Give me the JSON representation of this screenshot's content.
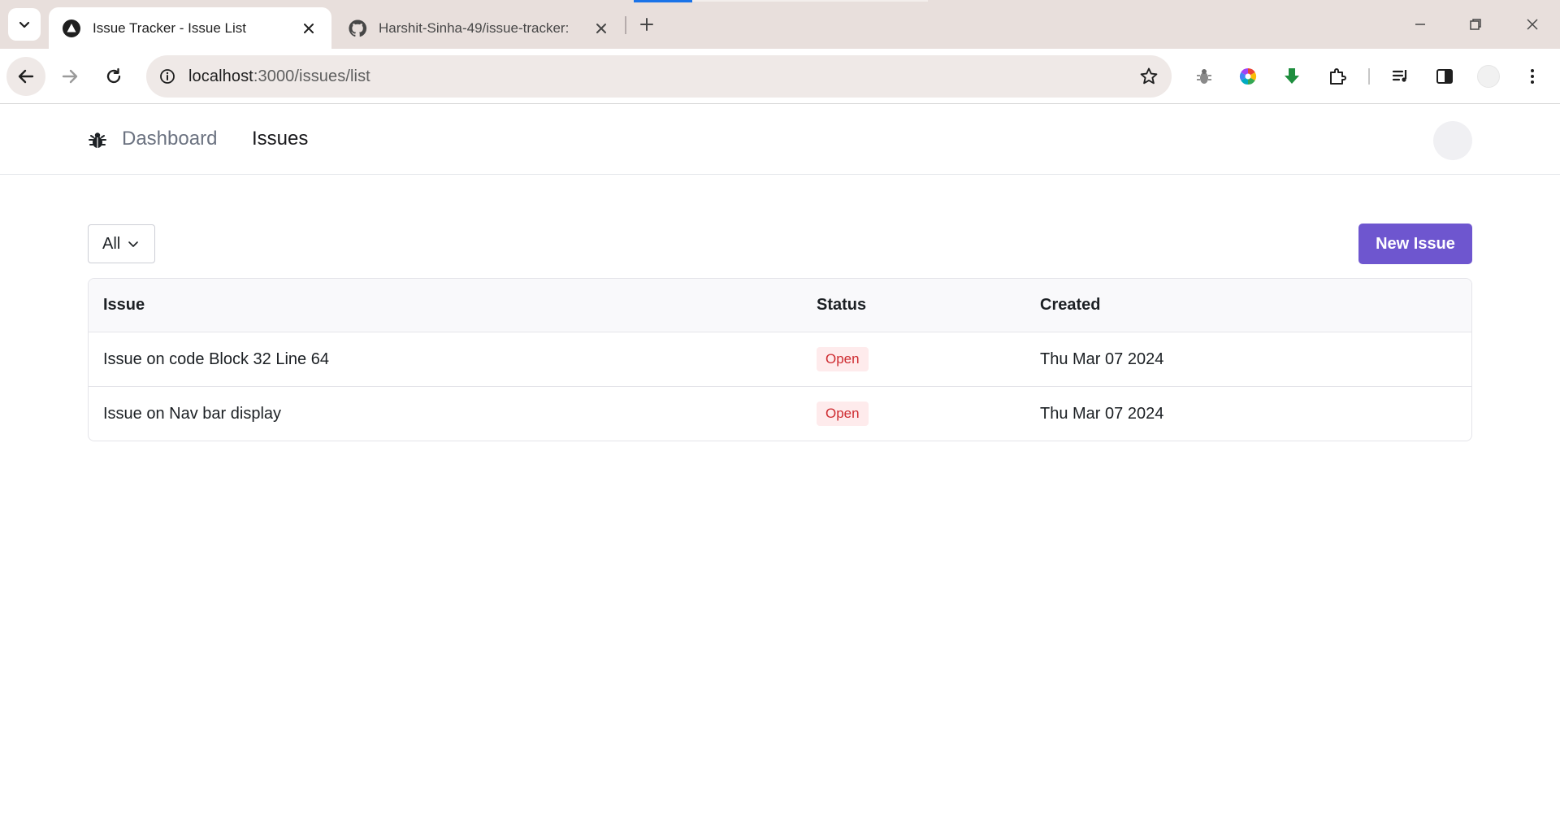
{
  "browser": {
    "tabs": [
      {
        "title": "Issue Tracker - Issue List",
        "active": true,
        "icon": "nextjs-triangle-icon"
      },
      {
        "title": "Harshit-Sinha-49/issue-tracker:",
        "active": false,
        "icon": "github-icon"
      }
    ],
    "url_host": "localhost",
    "url_path": ":3000/issues/list",
    "accent_color": "#1a73e8"
  },
  "app": {
    "nav": {
      "dashboard_label": "Dashboard",
      "issues_label": "Issues"
    },
    "filter": {
      "selected": "All"
    },
    "new_issue_label": "New Issue",
    "table": {
      "headers": {
        "issue": "Issue",
        "status": "Status",
        "created": "Created"
      },
      "rows": [
        {
          "title": "Issue on code Block 32 Line 64",
          "status": "Open",
          "created": "Thu Mar 07 2024"
        },
        {
          "title": "Issue on Nav bar display",
          "status": "Open",
          "created": "Thu Mar 07 2024"
        }
      ]
    },
    "colors": {
      "primary": "#6e56cf",
      "status_open_bg": "#feebec",
      "status_open_text": "#ce2c31"
    }
  }
}
